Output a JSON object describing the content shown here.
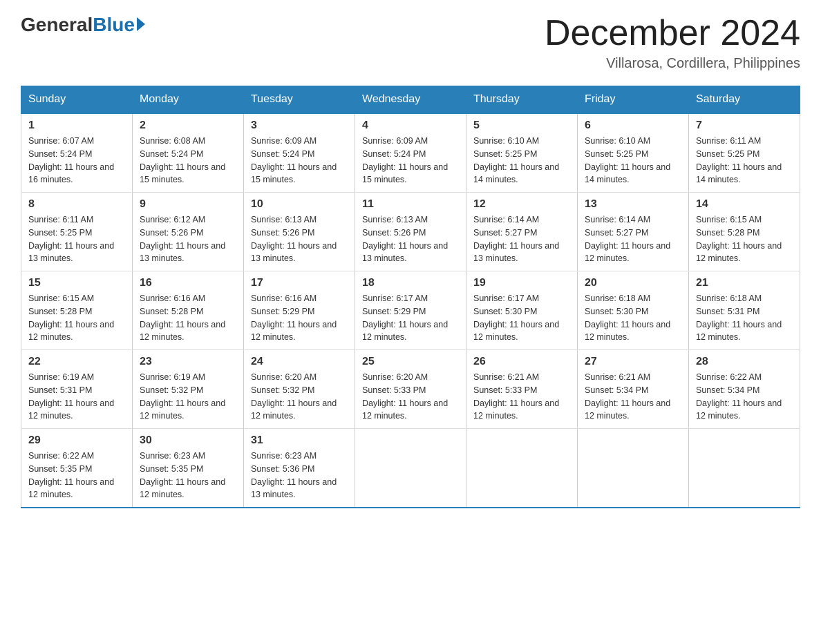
{
  "logo": {
    "general": "General",
    "blue": "Blue"
  },
  "title": "December 2024",
  "subtitle": "Villarosa, Cordillera, Philippines",
  "days_of_week": [
    "Sunday",
    "Monday",
    "Tuesday",
    "Wednesday",
    "Thursday",
    "Friday",
    "Saturday"
  ],
  "weeks": [
    [
      {
        "day": "1",
        "sunrise": "6:07 AM",
        "sunset": "5:24 PM",
        "daylight": "11 hours and 16 minutes."
      },
      {
        "day": "2",
        "sunrise": "6:08 AM",
        "sunset": "5:24 PM",
        "daylight": "11 hours and 15 minutes."
      },
      {
        "day": "3",
        "sunrise": "6:09 AM",
        "sunset": "5:24 PM",
        "daylight": "11 hours and 15 minutes."
      },
      {
        "day": "4",
        "sunrise": "6:09 AM",
        "sunset": "5:24 PM",
        "daylight": "11 hours and 15 minutes."
      },
      {
        "day": "5",
        "sunrise": "6:10 AM",
        "sunset": "5:25 PM",
        "daylight": "11 hours and 14 minutes."
      },
      {
        "day": "6",
        "sunrise": "6:10 AM",
        "sunset": "5:25 PM",
        "daylight": "11 hours and 14 minutes."
      },
      {
        "day": "7",
        "sunrise": "6:11 AM",
        "sunset": "5:25 PM",
        "daylight": "11 hours and 14 minutes."
      }
    ],
    [
      {
        "day": "8",
        "sunrise": "6:11 AM",
        "sunset": "5:25 PM",
        "daylight": "11 hours and 13 minutes."
      },
      {
        "day": "9",
        "sunrise": "6:12 AM",
        "sunset": "5:26 PM",
        "daylight": "11 hours and 13 minutes."
      },
      {
        "day": "10",
        "sunrise": "6:13 AM",
        "sunset": "5:26 PM",
        "daylight": "11 hours and 13 minutes."
      },
      {
        "day": "11",
        "sunrise": "6:13 AM",
        "sunset": "5:26 PM",
        "daylight": "11 hours and 13 minutes."
      },
      {
        "day": "12",
        "sunrise": "6:14 AM",
        "sunset": "5:27 PM",
        "daylight": "11 hours and 13 minutes."
      },
      {
        "day": "13",
        "sunrise": "6:14 AM",
        "sunset": "5:27 PM",
        "daylight": "11 hours and 12 minutes."
      },
      {
        "day": "14",
        "sunrise": "6:15 AM",
        "sunset": "5:28 PM",
        "daylight": "11 hours and 12 minutes."
      }
    ],
    [
      {
        "day": "15",
        "sunrise": "6:15 AM",
        "sunset": "5:28 PM",
        "daylight": "11 hours and 12 minutes."
      },
      {
        "day": "16",
        "sunrise": "6:16 AM",
        "sunset": "5:28 PM",
        "daylight": "11 hours and 12 minutes."
      },
      {
        "day": "17",
        "sunrise": "6:16 AM",
        "sunset": "5:29 PM",
        "daylight": "11 hours and 12 minutes."
      },
      {
        "day": "18",
        "sunrise": "6:17 AM",
        "sunset": "5:29 PM",
        "daylight": "11 hours and 12 minutes."
      },
      {
        "day": "19",
        "sunrise": "6:17 AM",
        "sunset": "5:30 PM",
        "daylight": "11 hours and 12 minutes."
      },
      {
        "day": "20",
        "sunrise": "6:18 AM",
        "sunset": "5:30 PM",
        "daylight": "11 hours and 12 minutes."
      },
      {
        "day": "21",
        "sunrise": "6:18 AM",
        "sunset": "5:31 PM",
        "daylight": "11 hours and 12 minutes."
      }
    ],
    [
      {
        "day": "22",
        "sunrise": "6:19 AM",
        "sunset": "5:31 PM",
        "daylight": "11 hours and 12 minutes."
      },
      {
        "day": "23",
        "sunrise": "6:19 AM",
        "sunset": "5:32 PM",
        "daylight": "11 hours and 12 minutes."
      },
      {
        "day": "24",
        "sunrise": "6:20 AM",
        "sunset": "5:32 PM",
        "daylight": "11 hours and 12 minutes."
      },
      {
        "day": "25",
        "sunrise": "6:20 AM",
        "sunset": "5:33 PM",
        "daylight": "11 hours and 12 minutes."
      },
      {
        "day": "26",
        "sunrise": "6:21 AM",
        "sunset": "5:33 PM",
        "daylight": "11 hours and 12 minutes."
      },
      {
        "day": "27",
        "sunrise": "6:21 AM",
        "sunset": "5:34 PM",
        "daylight": "11 hours and 12 minutes."
      },
      {
        "day": "28",
        "sunrise": "6:22 AM",
        "sunset": "5:34 PM",
        "daylight": "11 hours and 12 minutes."
      }
    ],
    [
      {
        "day": "29",
        "sunrise": "6:22 AM",
        "sunset": "5:35 PM",
        "daylight": "11 hours and 12 minutes."
      },
      {
        "day": "30",
        "sunrise": "6:23 AM",
        "sunset": "5:35 PM",
        "daylight": "11 hours and 12 minutes."
      },
      {
        "day": "31",
        "sunrise": "6:23 AM",
        "sunset": "5:36 PM",
        "daylight": "11 hours and 13 minutes."
      },
      null,
      null,
      null,
      null
    ]
  ]
}
